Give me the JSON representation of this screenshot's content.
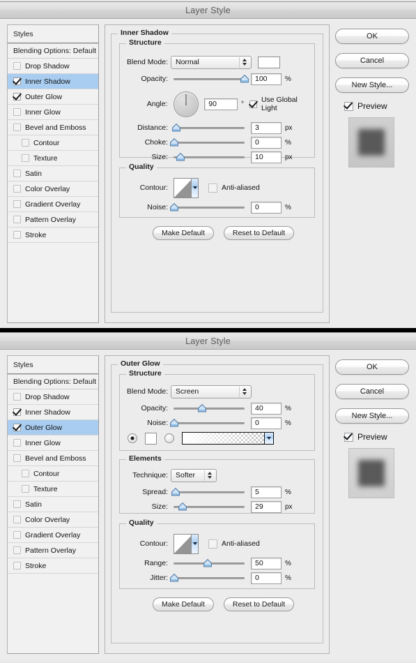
{
  "window": {
    "title": "Layer Style"
  },
  "sidebar": {
    "styles_label": "Styles",
    "blending_label": "Blending Options: Default",
    "items": [
      {
        "label": "Drop Shadow",
        "checked": false,
        "indent": false
      },
      {
        "label": "Inner Shadow",
        "checked": true,
        "indent": false
      },
      {
        "label": "Outer Glow",
        "checked": true,
        "indent": false
      },
      {
        "label": "Inner Glow",
        "checked": false,
        "indent": false
      },
      {
        "label": "Bevel and Emboss",
        "checked": false,
        "indent": false
      },
      {
        "label": "Contour",
        "checked": false,
        "indent": true
      },
      {
        "label": "Texture",
        "checked": false,
        "indent": true
      },
      {
        "label": "Satin",
        "checked": false,
        "indent": false
      },
      {
        "label": "Color Overlay",
        "checked": false,
        "indent": false
      },
      {
        "label": "Gradient Overlay",
        "checked": false,
        "indent": false
      },
      {
        "label": "Pattern Overlay",
        "checked": false,
        "indent": false
      },
      {
        "label": "Stroke",
        "checked": false,
        "indent": false
      }
    ]
  },
  "buttons": {
    "ok": "OK",
    "cancel": "Cancel",
    "new_style": "New Style...",
    "preview": "Preview",
    "make_default": "Make Default",
    "reset_to_default": "Reset to Default"
  },
  "dialog1": {
    "section_title": "Inner Shadow",
    "selected_item": "Inner Shadow",
    "structure": {
      "legend": "Structure",
      "blend_mode_label": "Blend Mode:",
      "blend_mode_value": "Normal",
      "opacity_label": "Opacity:",
      "opacity_value": "100",
      "opacity_unit": "%",
      "angle_label": "Angle:",
      "angle_value": "90",
      "angle_unit": "°",
      "use_global_light": "Use Global Light",
      "use_global_light_checked": true,
      "distance_label": "Distance:",
      "distance_value": "3",
      "distance_unit": "px",
      "choke_label": "Choke:",
      "choke_value": "0",
      "choke_unit": "%",
      "size_label": "Size:",
      "size_value": "10",
      "size_unit": "px"
    },
    "quality": {
      "legend": "Quality",
      "contour_label": "Contour:",
      "anti_aliased": "Anti-aliased",
      "anti_aliased_checked": false,
      "noise_label": "Noise:",
      "noise_value": "0",
      "noise_unit": "%"
    }
  },
  "dialog2": {
    "section_title": "Outer Glow",
    "selected_item": "Outer Glow",
    "structure": {
      "legend": "Structure",
      "blend_mode_label": "Blend Mode:",
      "blend_mode_value": "Screen",
      "opacity_label": "Opacity:",
      "opacity_value": "40",
      "opacity_unit": "%",
      "noise_label": "Noise:",
      "noise_value": "0",
      "noise_unit": "%"
    },
    "elements": {
      "legend": "Elements",
      "technique_label": "Technique:",
      "technique_value": "Softer",
      "spread_label": "Spread:",
      "spread_value": "5",
      "spread_unit": "%",
      "size_label": "Size:",
      "size_value": "29",
      "size_unit": "px"
    },
    "quality": {
      "legend": "Quality",
      "contour_label": "Contour:",
      "anti_aliased": "Anti-aliased",
      "anti_aliased_checked": false,
      "range_label": "Range:",
      "range_value": "50",
      "range_unit": "%",
      "jitter_label": "Jitter:",
      "jitter_value": "0",
      "jitter_unit": "%"
    }
  },
  "colors": {
    "selection_blue": "#a9cdf0",
    "dialog_bg": "#ececec",
    "panel_bg": "#f1f1f1",
    "border": "#b2b2b2",
    "text": "#111111",
    "title_text": "#5b5b5b"
  }
}
